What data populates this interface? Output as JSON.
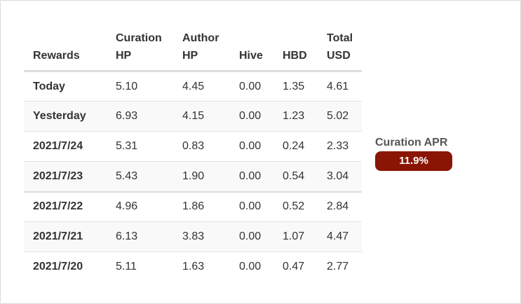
{
  "table": {
    "headers": [
      "Rewards",
      "Curation\nHP",
      "Author\nHP",
      "Hive",
      "HBD",
      "Total\nUSD"
    ],
    "rows": [
      {
        "label": "Today",
        "curation_hp": "5.10",
        "author_hp": "4.45",
        "hive": "0.00",
        "hbd": "1.35",
        "total_usd": "4.61"
      },
      {
        "label": "Yesterday",
        "curation_hp": "6.93",
        "author_hp": "4.15",
        "hive": "0.00",
        "hbd": "1.23",
        "total_usd": "5.02"
      },
      {
        "label": "2021/7/24",
        "curation_hp": "5.31",
        "author_hp": "0.83",
        "hive": "0.00",
        "hbd": "0.24",
        "total_usd": "2.33"
      },
      {
        "label": "2021/7/23",
        "curation_hp": "5.43",
        "author_hp": "1.90",
        "hive": "0.00",
        "hbd": "0.54",
        "total_usd": "3.04"
      },
      {
        "label": "2021/7/22",
        "curation_hp": "4.96",
        "author_hp": "1.86",
        "hive": "0.00",
        "hbd": "0.52",
        "total_usd": "2.84"
      },
      {
        "label": "2021/7/21",
        "curation_hp": "6.13",
        "author_hp": "3.83",
        "hive": "0.00",
        "hbd": "1.07",
        "total_usd": "4.47"
      },
      {
        "label": "2021/7/20",
        "curation_hp": "5.11",
        "author_hp": "1.63",
        "hive": "0.00",
        "hbd": "0.47",
        "total_usd": "2.77"
      }
    ]
  },
  "curation_apr": {
    "label": "Curation APR",
    "value": "11.9%",
    "badge_color": "#8b1505"
  },
  "colors": {
    "header_text": "#333333",
    "row_stripe": "#f9f9f9",
    "border": "#dddddd"
  }
}
